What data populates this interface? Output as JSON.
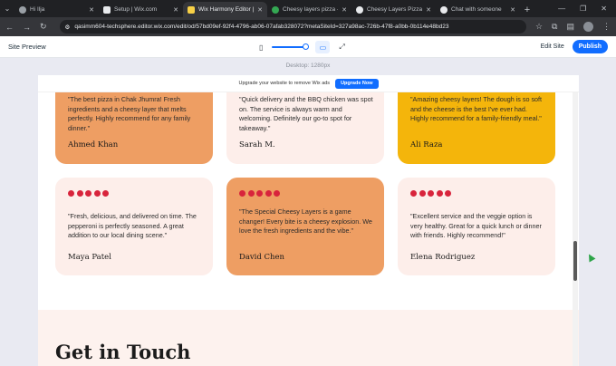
{
  "browser": {
    "tabs": [
      {
        "label": "Hi Ilja",
        "active": false
      },
      {
        "label": "Setup | Wix.com",
        "active": false
      },
      {
        "label": "Wix Harmony Editor | Te",
        "active": true
      },
      {
        "label": "Cheesy layers pizza - Go",
        "active": false
      },
      {
        "label": "Cheesy Layers Pizza | Go",
        "active": false
      },
      {
        "label": "Chat with someone",
        "active": false
      }
    ],
    "url": "qasimm604-techsphere.editor.wix.com/edit/od/57bd09ef-92f4-4796-ab06-07afab328072?metaSiteId=327a98ac-726b-47f8-a0bb-0b114e48bd23"
  },
  "wix": {
    "title": "Site Preview",
    "edit_site": "Edit Site",
    "publish": "Publish",
    "desktop_label": "Desktop: 1280px"
  },
  "site": {
    "ad_text": "Upgrade your website to remove Wix ads",
    "ad_button": "Upgrade Now",
    "testimonials": [
      {
        "quote": "\"The best pizza in Chak Jhumra! Fresh ingredients and a cheesy layer that melts perfectly. Highly recommend for any family dinner.\"",
        "author": "Ahmed Khan"
      },
      {
        "quote": "\"Quick delivery and the BBQ chicken was spot on. The service is always warm and welcoming. Definitely our go-to spot for takeaway.\"",
        "author": "Sarah M."
      },
      {
        "quote": "\"Amazing cheesy layers! The dough is so soft and the cheese is the best I've ever had. Highly recommend for a family-friendly meal.\"",
        "author": "Ali Raza"
      },
      {
        "quote": "\"Fresh, delicious, and delivered on time. The pepperoni is perfectly seasoned. A great addition to our local dining scene.\"",
        "author": "Maya Patel"
      },
      {
        "quote": "\"The Special Cheesy Layers is a game changer! Every bite is a cheesy explosion. We love the fresh ingredients and the vibe.\"",
        "author": "David Chen"
      },
      {
        "quote": "\"Excellent service and the veggie option is very healthy. Great for a quick lunch or dinner with friends. Highly recommend!\"",
        "author": "Elena Rodriguez"
      }
    ],
    "contact_title": "Get in Touch"
  },
  "colors": {
    "accent": "#116dff",
    "card_pink": "#fdeeea",
    "card_orange": "#ee9e63",
    "card_yellow": "#f4b50b",
    "star": "#d8243c"
  }
}
